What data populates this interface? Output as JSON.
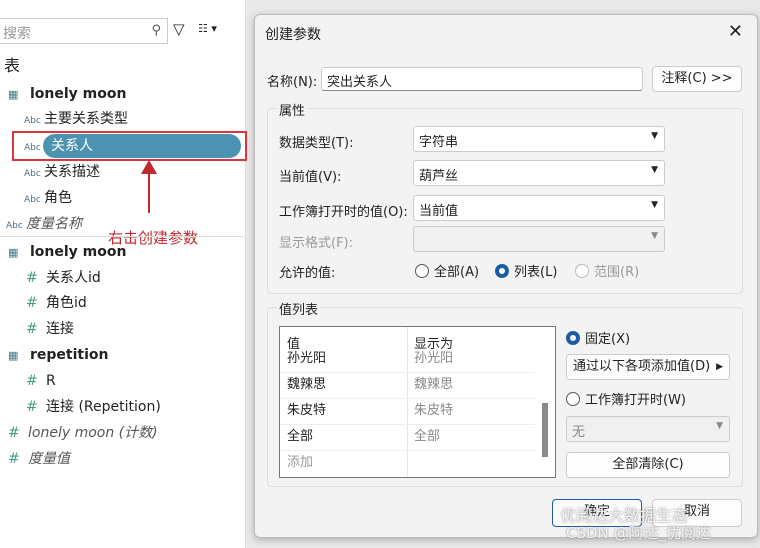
{
  "left_panel": {
    "search_placeholder": "搜索",
    "section_title": "表",
    "items": [
      {
        "label": "lonely moon",
        "type": "table"
      },
      {
        "label": "主要关系类型",
        "type": "Abc"
      },
      {
        "label": "关系人",
        "type": "Abc",
        "selected": true
      },
      {
        "label": "关系描述",
        "type": "Abc"
      },
      {
        "label": "角色",
        "type": "Abc"
      },
      {
        "label": "度量名称",
        "type": "Abc"
      },
      {
        "label": "lonely moon",
        "type": "table"
      },
      {
        "label": "关系人id",
        "type": "#"
      },
      {
        "label": "角色id",
        "type": "#"
      },
      {
        "label": "连接",
        "type": "#"
      },
      {
        "label": "repetition",
        "type": "table"
      },
      {
        "label": "R",
        "type": "#"
      },
      {
        "label": "连接 (Repetition)",
        "type": "#"
      },
      {
        "label": "lonely moon (计数)",
        "type": "#"
      },
      {
        "label": "度量值",
        "type": "#"
      }
    ],
    "abc": "Abc",
    "annotation": "右击创建参数"
  },
  "dialog": {
    "title": "创建参数",
    "name_label": "名称(N):",
    "name_value": "突出关系人",
    "comment_button": "注释(C) >>",
    "props_title": "属性",
    "data_type_label": "数据类型(T):",
    "data_type_value": "字符串",
    "current_label": "当前值(V):",
    "current_value": "葫芦丝",
    "open_label": "工作簿打开时的值(O):",
    "open_value": "当前值",
    "format_label": "显示格式(F):",
    "allowed_label": "允许的值:",
    "allowed_options": [
      "全部(A)",
      "列表(L)",
      "范围(R)"
    ],
    "list_title": "值列表",
    "col_value": "值",
    "col_display": "显示为",
    "rows": [
      [
        "孙光阳",
        "孙光阳"
      ],
      [
        "魏辣思",
        "魏辣思"
      ],
      [
        "朱皮特",
        "朱皮特"
      ],
      [
        "全部",
        "全部"
      ]
    ],
    "add_row": "添加",
    "fixed_label": "固定(X)",
    "add_from_button": "通过以下各项添加值(D)",
    "workbook_open_label": "工作簿打开时(W)",
    "none_value": "无",
    "clear_all_button": "全部清除(C)",
    "ok_button": "确定",
    "cancel_button": "取消"
  },
  "watermark": {
    "line1": "优阅达大数据生态",
    "line2": "CSDN @阿达_优阅达"
  },
  "colors": {
    "selection": "#4c93b1",
    "annotation": "#c0282e",
    "radio": "#1b5ca6"
  }
}
